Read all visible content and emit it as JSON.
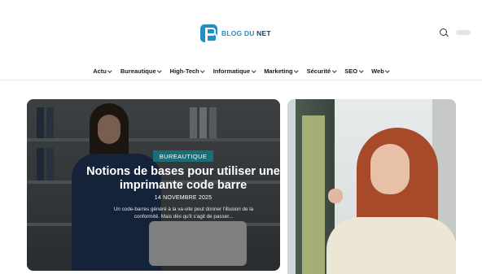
{
  "brand": {
    "logo_text_1": "BLOG DU",
    "logo_text_2": " NET",
    "colors": {
      "primary": "#1f8fc9",
      "dark": "#1b3a5c",
      "badge": "#1a6e7a"
    }
  },
  "header": {
    "search_icon": "search-icon",
    "toggle": "dark-mode-toggle"
  },
  "nav": {
    "items": [
      {
        "label": "Actu"
      },
      {
        "label": "Bureautique"
      },
      {
        "label": "High-Tech"
      },
      {
        "label": "Informatique"
      },
      {
        "label": "Marketing"
      },
      {
        "label": "Sécurité"
      },
      {
        "label": "SEO"
      },
      {
        "label": "Web"
      }
    ]
  },
  "featured": {
    "category": "BUREAUTIQUE",
    "title": "Notions de bases pour utiliser une imprimante code barre",
    "date": "14 NOVEMBRE 2025",
    "excerpt": "Un code-barres généré à la va-vite peut donner l'illusion de la conformité. Mais dès qu'il s'agit de passer..."
  }
}
